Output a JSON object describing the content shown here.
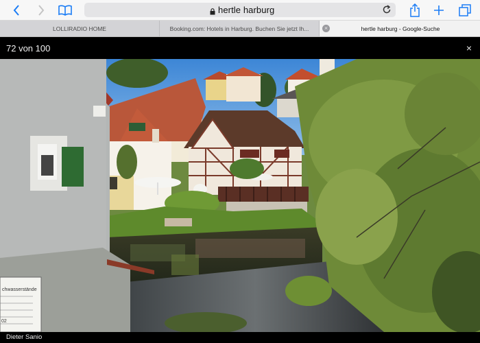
{
  "browser": {
    "url": "hertle harburg",
    "tabs": [
      {
        "label": "LOLLIRADIO HOME"
      },
      {
        "label": "Booking.com: Hotels in Harburg. Buchen Sie jetzt Ih..."
      },
      {
        "label": "hertle harburg - Google-Suche",
        "active": true
      }
    ],
    "icons": {
      "back": "back-chevron-icon",
      "forward": "forward-chevron-icon",
      "bookmarks": "bookmarks-book-icon",
      "lock": "lock-icon",
      "reload": "reload-icon",
      "share": "share-icon",
      "new_tab": "plus-icon",
      "tabs": "tabs-overview-icon",
      "tab_close": "×"
    },
    "accent_color": "#1a7cf5"
  },
  "viewer": {
    "counter": "72 von 100",
    "close": "×",
    "photo_credit": "Dieter Sanio",
    "sign_text": "chwasserstände",
    "sign_numbers": "02"
  }
}
